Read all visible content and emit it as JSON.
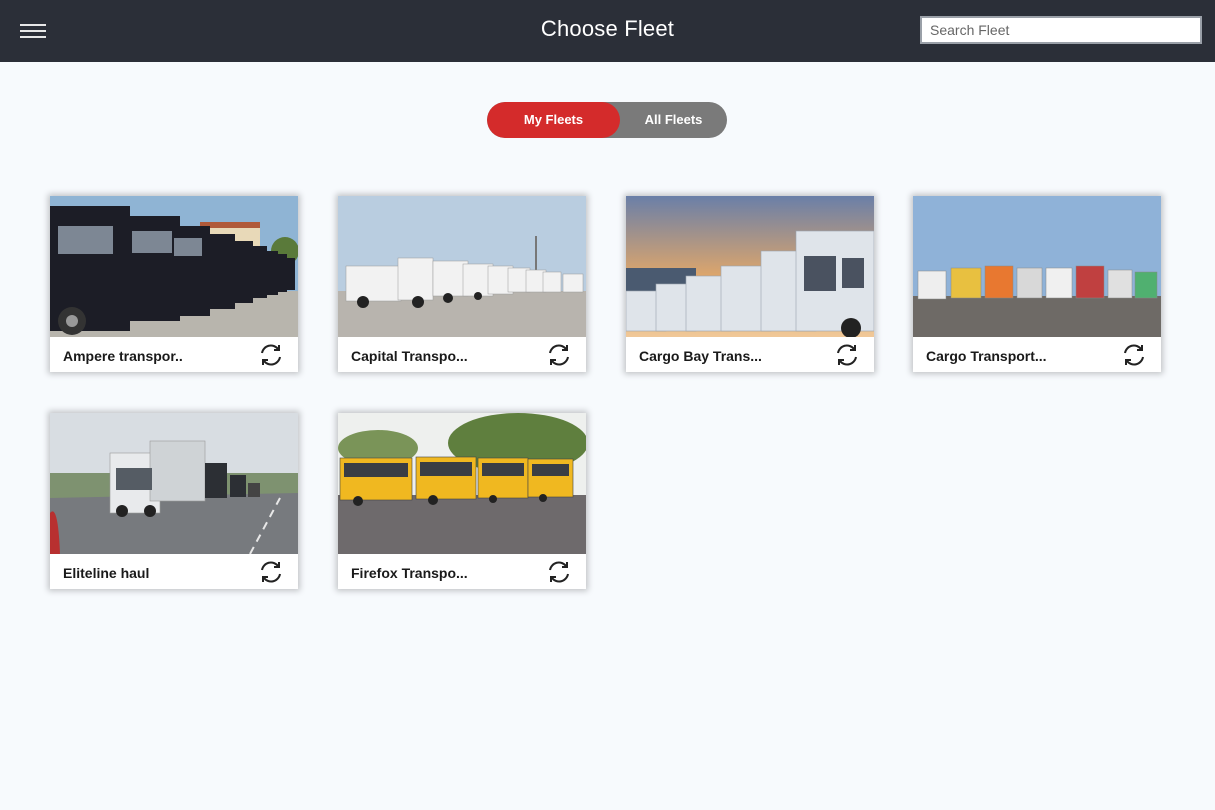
{
  "header": {
    "title": "Choose Fleet",
    "menu_icon": "hamburger-menu-icon",
    "search_placeholder": "Search Fleet"
  },
  "toggle": {
    "my_fleets": "My Fleets",
    "all_fleets": "All Fleets",
    "active": "my_fleets",
    "active_color": "#d42b2b",
    "inactive_color": "#7a7a7a"
  },
  "fleets": [
    {
      "name": "Ampere transpor..",
      "image": "dark-trucks-row"
    },
    {
      "name": "Capital Transpo...",
      "image": "white-garbage-trucks"
    },
    {
      "name": "Cargo Bay Trans...",
      "image": "white-trucks-sunset"
    },
    {
      "name": "Cargo Transport...",
      "image": "colorful-semi-trucks"
    },
    {
      "name": "Eliteline haul",
      "image": "truck-on-highway"
    },
    {
      "name": "Firefox Transpo...",
      "image": "yellow-buses"
    }
  ],
  "icons": {
    "sync": "sync-icon"
  }
}
